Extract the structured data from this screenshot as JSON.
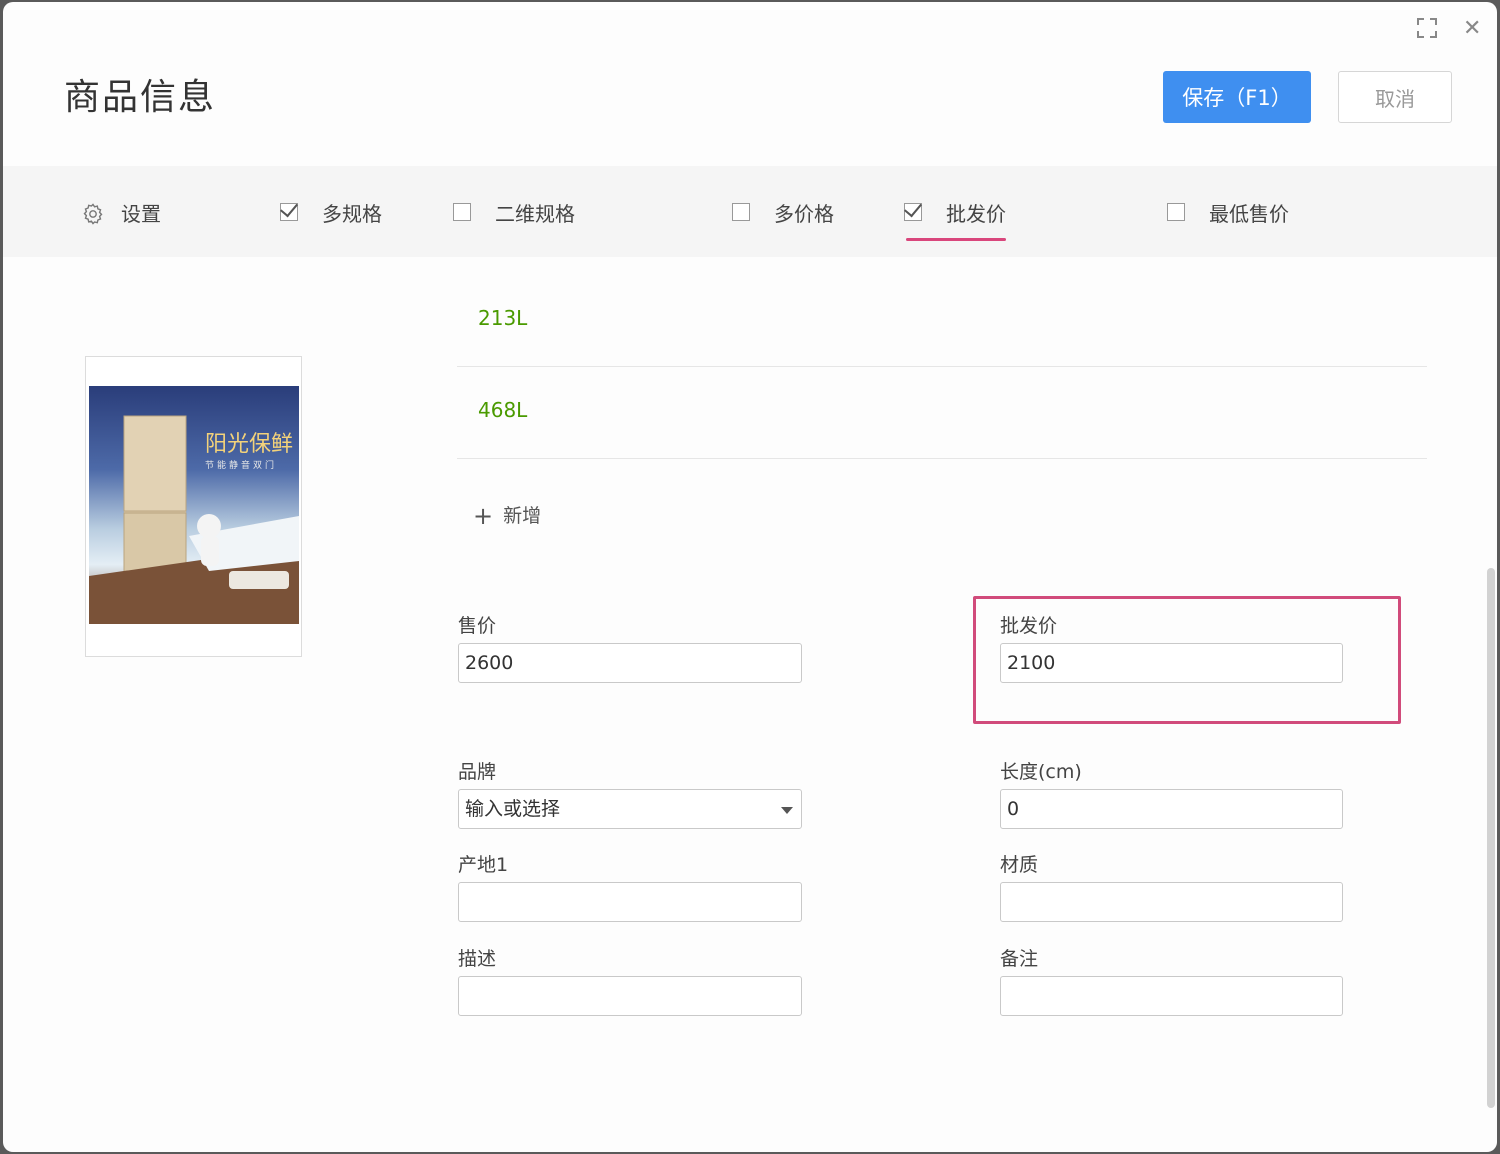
{
  "window": {
    "title": "商品信息",
    "save_label": "保存（F1）",
    "cancel_label": "取消",
    "maximize_icon": "maximize-icon",
    "close_icon": "close-icon",
    "close_glyph": "✕"
  },
  "toolbar": {
    "settings_label": "设置",
    "options": [
      {
        "label": "多规格",
        "checked": true
      },
      {
        "label": "二维规格",
        "checked": false
      },
      {
        "label": "多价格",
        "checked": false
      },
      {
        "label": "批发价",
        "checked": true,
        "active": true
      },
      {
        "label": "最低售价",
        "checked": false
      }
    ],
    "active_underline_color": "#d9467c"
  },
  "specs": {
    "items": [
      "213L",
      "468L"
    ],
    "add_label": "新增",
    "add_glyph": "+"
  },
  "image": {
    "text_line1": "阳光保鲜",
    "text_line2": "节能静音双门"
  },
  "form": {
    "sale_price": {
      "label": "售价",
      "value": "2600"
    },
    "wholesale_price": {
      "label": "批发价",
      "value": "2100"
    },
    "brand": {
      "label": "品牌",
      "placeholder": "输入或选择",
      "value": "输入或选择"
    },
    "length": {
      "label": "长度(cm)",
      "value": "0"
    },
    "origin": {
      "label": "产地1",
      "value": ""
    },
    "material": {
      "label": "材质",
      "value": ""
    },
    "description": {
      "label": "描述",
      "value": ""
    },
    "remark": {
      "label": "备注",
      "value": ""
    }
  },
  "colors": {
    "accent": "#3f8ff0",
    "spec_text": "#4a9a00",
    "highlight": "#d14b7b"
  }
}
